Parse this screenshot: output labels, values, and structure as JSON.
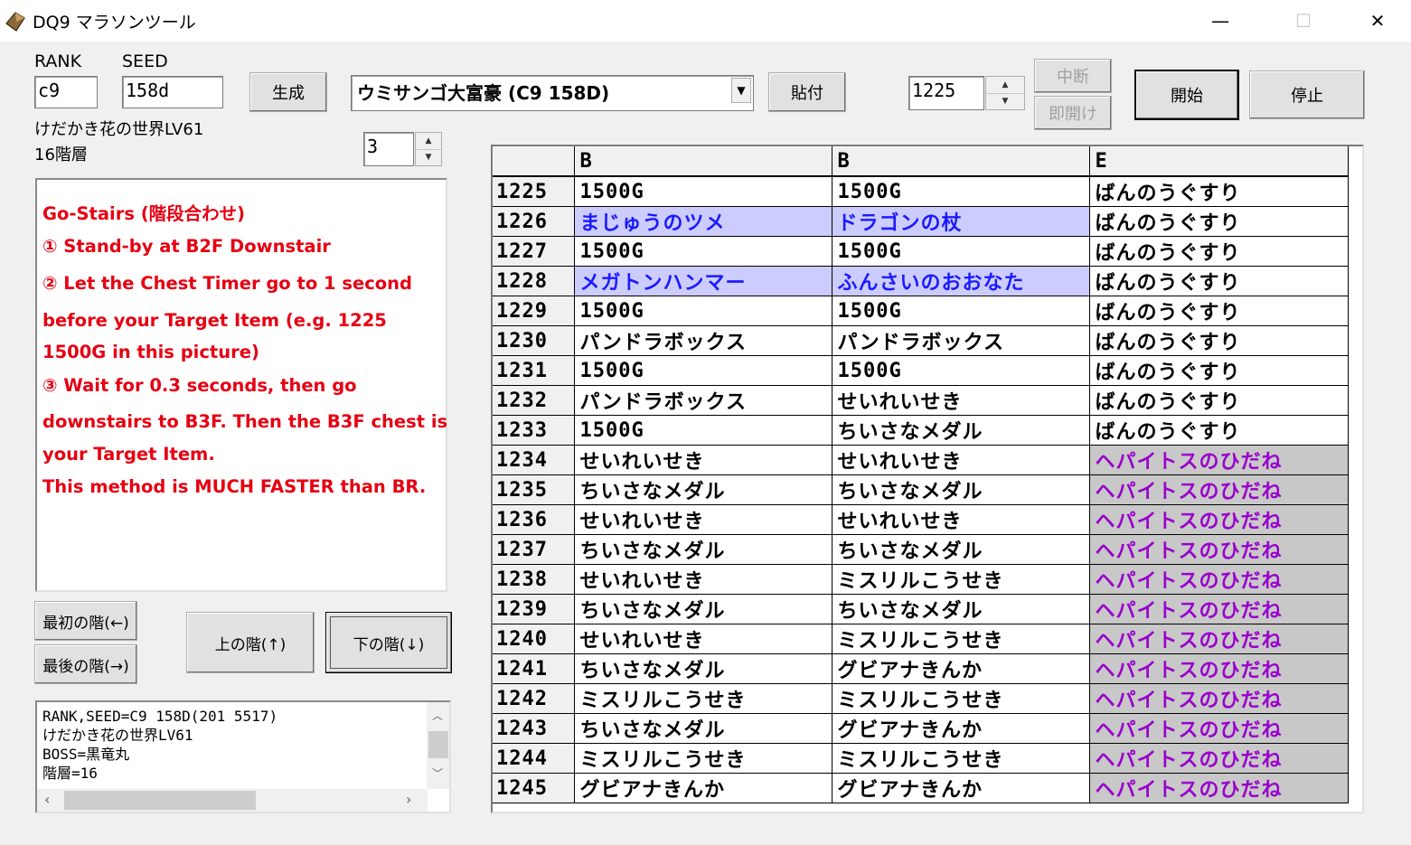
{
  "window": {
    "title": "DQ9 マラソンツール",
    "minimize": "—",
    "maximize": "☐",
    "close": "✕"
  },
  "controls": {
    "rank_label": "RANK",
    "seed_label": "SEED",
    "rank_value": "c9",
    "seed_value": "158d",
    "generate_button": "生成",
    "map_select": "ウミサンゴ大富豪 (C9 158D)",
    "paste_button": "貼付",
    "counter_value": "1225",
    "suspend_button": "中断",
    "instant_open_button": "即開け",
    "start_button": "開始",
    "stop_button": "停止"
  },
  "map_info": {
    "name": "けだかき花の世界LV61",
    "floors": "16階層",
    "floor_value": "3"
  },
  "memo": {
    "lines": [
      "Go-Stairs (階段合わせ)",
      "① Stand-by at B2F Downstair",
      "② Let the Chest Timer go to 1 second",
      "before your Target Item (e.g. 1225",
      "1500G in this picture)",
      "③ Wait for 0.3 seconds, then go",
      "downstairs to B3F. Then the B3F chest is",
      "your Target Item.",
      "This method is MUCH FASTER than BR."
    ]
  },
  "nav": {
    "first_floor": "最初の階(←)",
    "last_floor": "最後の階(→)",
    "upper_floor": "上の階(↑)",
    "lower_floor": "下の階(↓)"
  },
  "log": {
    "lines": [
      "RANK,SEED=C9 158D(201 5517)",
      "けだかき花の世界LV61",
      "BOSS=黒竜丸",
      "階層=16"
    ]
  },
  "table": {
    "headers": [
      "",
      "B",
      "B",
      "E"
    ],
    "rows": [
      {
        "n": "1225",
        "a": "1500G",
        "b": "1500G",
        "c": "ばんのうぐすり",
        "s": [
          "plain",
          "plain",
          "plain"
        ]
      },
      {
        "n": "1226",
        "a": "まじゅうのツメ",
        "b": "ドラゴンの杖",
        "c": "ばんのうぐすり",
        "s": [
          "blue",
          "blue",
          "plain"
        ]
      },
      {
        "n": "1227",
        "a": "1500G",
        "b": "1500G",
        "c": "ばんのうぐすり",
        "s": [
          "plain",
          "plain",
          "plain"
        ]
      },
      {
        "n": "1228",
        "a": "メガトンハンマー",
        "b": "ふんさいのおおなた",
        "c": "ばんのうぐすり",
        "s": [
          "blue",
          "blue",
          "plain"
        ]
      },
      {
        "n": "1229",
        "a": "1500G",
        "b": "1500G",
        "c": "ばんのうぐすり",
        "s": [
          "plain",
          "plain",
          "plain"
        ]
      },
      {
        "n": "1230",
        "a": "パンドラボックス",
        "b": "パンドラボックス",
        "c": "ばんのうぐすり",
        "s": [
          "plain",
          "plain",
          "plain"
        ]
      },
      {
        "n": "1231",
        "a": "1500G",
        "b": "1500G",
        "c": "ばんのうぐすり",
        "s": [
          "plain",
          "plain",
          "plain"
        ]
      },
      {
        "n": "1232",
        "a": "パンドラボックス",
        "b": "せいれいせき",
        "c": "ばんのうぐすり",
        "s": [
          "plain",
          "plain",
          "plain"
        ]
      },
      {
        "n": "1233",
        "a": "1500G",
        "b": "ちいさなメダル",
        "c": "ばんのうぐすり",
        "s": [
          "plain",
          "plain",
          "plain"
        ]
      },
      {
        "n": "1234",
        "a": "せいれいせき",
        "b": "せいれいせき",
        "c": "ヘパイトスのひだね",
        "s": [
          "plain",
          "plain",
          "purple"
        ]
      },
      {
        "n": "1235",
        "a": "ちいさなメダル",
        "b": "ちいさなメダル",
        "c": "ヘパイトスのひだね",
        "s": [
          "plain",
          "plain",
          "purple"
        ]
      },
      {
        "n": "1236",
        "a": "せいれいせき",
        "b": "せいれいせき",
        "c": "ヘパイトスのひだね",
        "s": [
          "plain",
          "plain",
          "purple"
        ]
      },
      {
        "n": "1237",
        "a": "ちいさなメダル",
        "b": "ちいさなメダル",
        "c": "ヘパイトスのひだね",
        "s": [
          "plain",
          "plain",
          "purple"
        ]
      },
      {
        "n": "1238",
        "a": "せいれいせき",
        "b": "ミスリルこうせき",
        "c": "ヘパイトスのひだね",
        "s": [
          "plain",
          "plain",
          "purple"
        ]
      },
      {
        "n": "1239",
        "a": "ちいさなメダル",
        "b": "ちいさなメダル",
        "c": "ヘパイトスのひだね",
        "s": [
          "plain",
          "plain",
          "purple"
        ]
      },
      {
        "n": "1240",
        "a": "せいれいせき",
        "b": "ミスリルこうせき",
        "c": "ヘパイトスのひだね",
        "s": [
          "plain",
          "plain",
          "purple"
        ]
      },
      {
        "n": "1241",
        "a": "ちいさなメダル",
        "b": "グビアナきんか",
        "c": "ヘパイトスのひだね",
        "s": [
          "plain",
          "plain",
          "purple"
        ]
      },
      {
        "n": "1242",
        "a": "ミスリルこうせき",
        "b": "ミスリルこうせき",
        "c": "ヘパイトスのひだね",
        "s": [
          "plain",
          "plain",
          "purple"
        ]
      },
      {
        "n": "1243",
        "a": "ちいさなメダル",
        "b": "グビアナきんか",
        "c": "ヘパイトスのひだね",
        "s": [
          "plain",
          "plain",
          "purple"
        ]
      },
      {
        "n": "1244",
        "a": "ミスリルこうせき",
        "b": "ミスリルこうせき",
        "c": "ヘパイトスのひだね",
        "s": [
          "plain",
          "plain",
          "purple"
        ]
      },
      {
        "n": "1245",
        "a": "グビアナきんか",
        "b": "グビアナきんか",
        "c": "ヘパイトスのひだね",
        "s": [
          "plain",
          "plain",
          "purple"
        ]
      }
    ]
  },
  "colors": {
    "memo_text": "#e60012",
    "rare_bg": "#ccccff",
    "rare_text": "#1a1aff",
    "special_bg": "#c8c8c8",
    "special_text": "#9900cc"
  }
}
